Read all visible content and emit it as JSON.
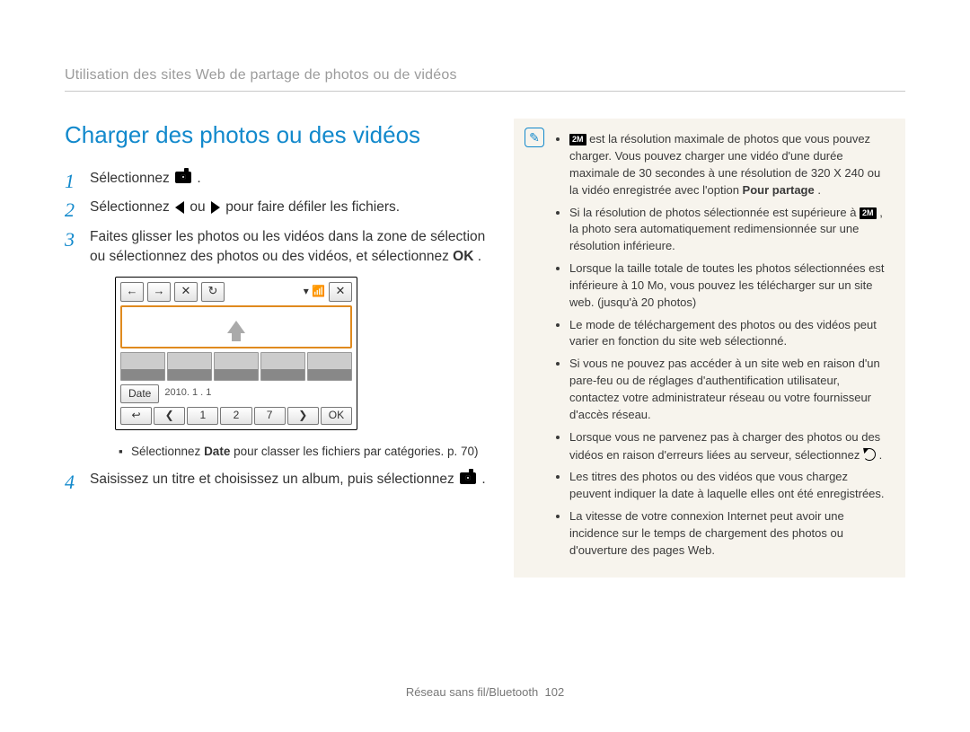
{
  "runningHead": "Utilisation des sites Web de partage de photos ou de vidéos",
  "sectionTitle": "Charger des photos ou des vidéos",
  "steps": {
    "s1": "Sélectionnez ",
    "s1_end": ".",
    "s2_pre": "Sélectionnez ",
    "s2_mid": " ou ",
    "s2_post": " pour faire défiler les fichiers.",
    "s3": "Faites glisser les photos ou les vidéos dans la zone de sélection ou sélectionnez des photos ou des vidéos, et sélectionnez ",
    "s3_ok": "OK",
    "s3_end": ".",
    "s4_a": "Saisissez un titre et choisissez un album, puis sélectionnez ",
    "s4_end": "."
  },
  "screen": {
    "dateLabel": "Date",
    "dateValue": "2010. 1 . 1",
    "pager": {
      "back": "↩",
      "prev": "❮",
      "p1": "1",
      "p2": "2",
      "p3": "7",
      "next": "❯",
      "ok": "OK"
    }
  },
  "subBullet": {
    "pre": "Sélectionnez ",
    "bold": "Date",
    "post": " pour classer les fichiers par catégories. p. 70)"
  },
  "notes": {
    "n1_pre": " est la résolution maximale de photos que vous pouvez charger. Vous pouvez charger une vidéo d'une durée maximale de 30 secondes à une résolution de 320 X 240 ou la vidéo enregistrée avec l'option ",
    "n1_bold": "Pour partage",
    "n1_end": ".",
    "n2_pre": "Si la résolution de photos sélectionnée est supérieure à ",
    "n2_post": ", la photo sera automatiquement redimensionnée sur une résolution inférieure.",
    "n3": "Lorsque la taille totale de toutes les photos sélectionnées est inférieure à 10 Mo, vous pouvez les télécharger sur un site web. (jusqu'à 20 photos)",
    "n4": "Le mode de téléchargement des photos ou des vidéos peut varier en fonction du site web sélectionné.",
    "n5": "Si vous ne pouvez pas accéder à un site web en raison d'un pare-feu ou de réglages d'authentification utilisateur, contactez votre administrateur réseau ou votre fournisseur d'accès réseau.",
    "n6_pre": "Lorsque vous ne parvenez pas à charger des photos ou des vidéos en raison d'erreurs liées au serveur, sélectionnez ",
    "n6_end": ".",
    "n7": "Les titres des photos ou des vidéos que vous chargez peuvent indiquer la date à laquelle elles ont été enregistrées.",
    "n8": "La vitesse de votre connexion Internet peut avoir une incidence sur le temps de chargement des photos ou d'ouverture des pages Web."
  },
  "footer": {
    "label": "Réseau sans fil/Bluetooth",
    "page": "102"
  }
}
